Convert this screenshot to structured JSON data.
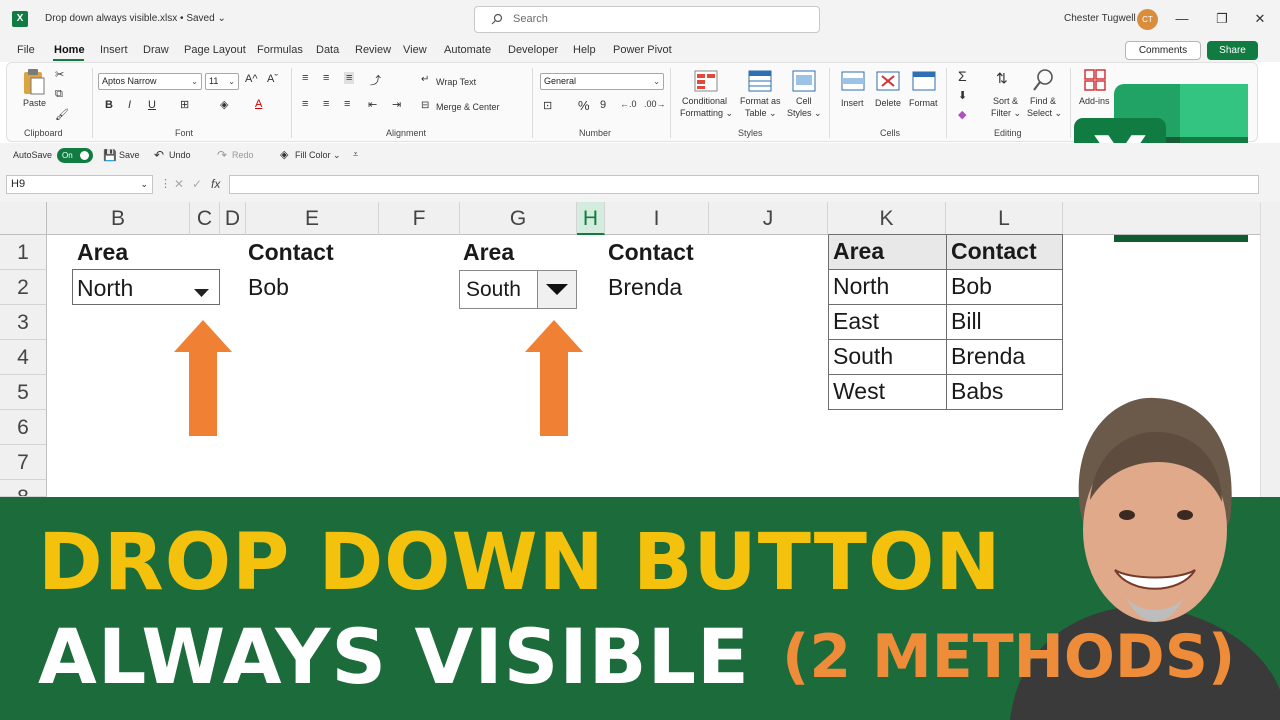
{
  "titlebar": {
    "doc_title": "Drop down always visible.xlsx • Saved ⌄",
    "search_placeholder": "Search",
    "user_name": "Chester Tugwell",
    "user_initials": "CT"
  },
  "tabs": [
    "File",
    "Home",
    "Insert",
    "Draw",
    "Page Layout",
    "Formulas",
    "Data",
    "Review",
    "View",
    "Automate",
    "Developer",
    "Help",
    "Power Pivot"
  ],
  "active_tab": "Home",
  "header_buttons": {
    "comments": "Comments",
    "share": "Share"
  },
  "ribbon": {
    "clipboard": {
      "paste": "Paste",
      "group": "Clipboard"
    },
    "font": {
      "name": "Aptos Narrow",
      "size": "11",
      "group": "Font"
    },
    "alignment": {
      "wrap_text": "Wrap Text",
      "merge_center": "Merge & Center",
      "group": "Alignment"
    },
    "number": {
      "format": "General",
      "group": "Number"
    },
    "styles": {
      "conditional_1": "Conditional",
      "conditional_2": "Formatting ⌄",
      "format_table_1": "Format as",
      "format_table_2": "Table ⌄",
      "cell_styles_1": "Cell",
      "cell_styles_2": "Styles ⌄",
      "group": "Styles"
    },
    "cells": {
      "insert": "Insert",
      "delete": "Delete",
      "format": "Format",
      "group": "Cells"
    },
    "editing": {
      "sort_1": "Sort &",
      "sort_2": "Filter ⌄",
      "find_1": "Find &",
      "find_2": "Select ⌄",
      "group": "Editing"
    },
    "addins": {
      "label": "Add-ins"
    }
  },
  "quick_access": {
    "autosave": "AutoSave",
    "autosave_state": "On",
    "save": "Save",
    "undo": "Undo",
    "redo": "Redo",
    "fill_color": "Fill Color ⌄"
  },
  "formula_bar": {
    "name_box": "H9",
    "fx": "fx",
    "formula": ""
  },
  "grid": {
    "columns": [
      "B",
      "C",
      "D",
      "E",
      "F",
      "G",
      "H",
      "I",
      "J",
      "K",
      "L"
    ],
    "selected_column": "H",
    "rows": [
      "1",
      "2",
      "3",
      "4",
      "5",
      "6",
      "7",
      "8"
    ],
    "method1": {
      "area_header": "Area",
      "contact_header": "Contact",
      "area_value": "North",
      "contact_value": "Bob"
    },
    "method2": {
      "area_header": "Area",
      "contact_header": "Contact",
      "area_value": "South",
      "contact_value": "Brenda"
    },
    "lookup_table": {
      "headers": [
        "Area",
        "Contact"
      ],
      "rows": [
        [
          "North",
          "Bob"
        ],
        [
          "East",
          "Bill"
        ],
        [
          "South",
          "Brenda"
        ],
        [
          "West",
          "Babs"
        ]
      ]
    }
  },
  "banner": {
    "line1": "DROP DOWN BUTTON",
    "line2": "ALWAYS VISIBLE",
    "line3": "(2 METHODS)"
  },
  "colors": {
    "excel_green": "#107c41",
    "banner_green": "#1c6b3a",
    "headline_yellow": "#f4c20d",
    "arrow_orange": "#ef8c3a"
  }
}
